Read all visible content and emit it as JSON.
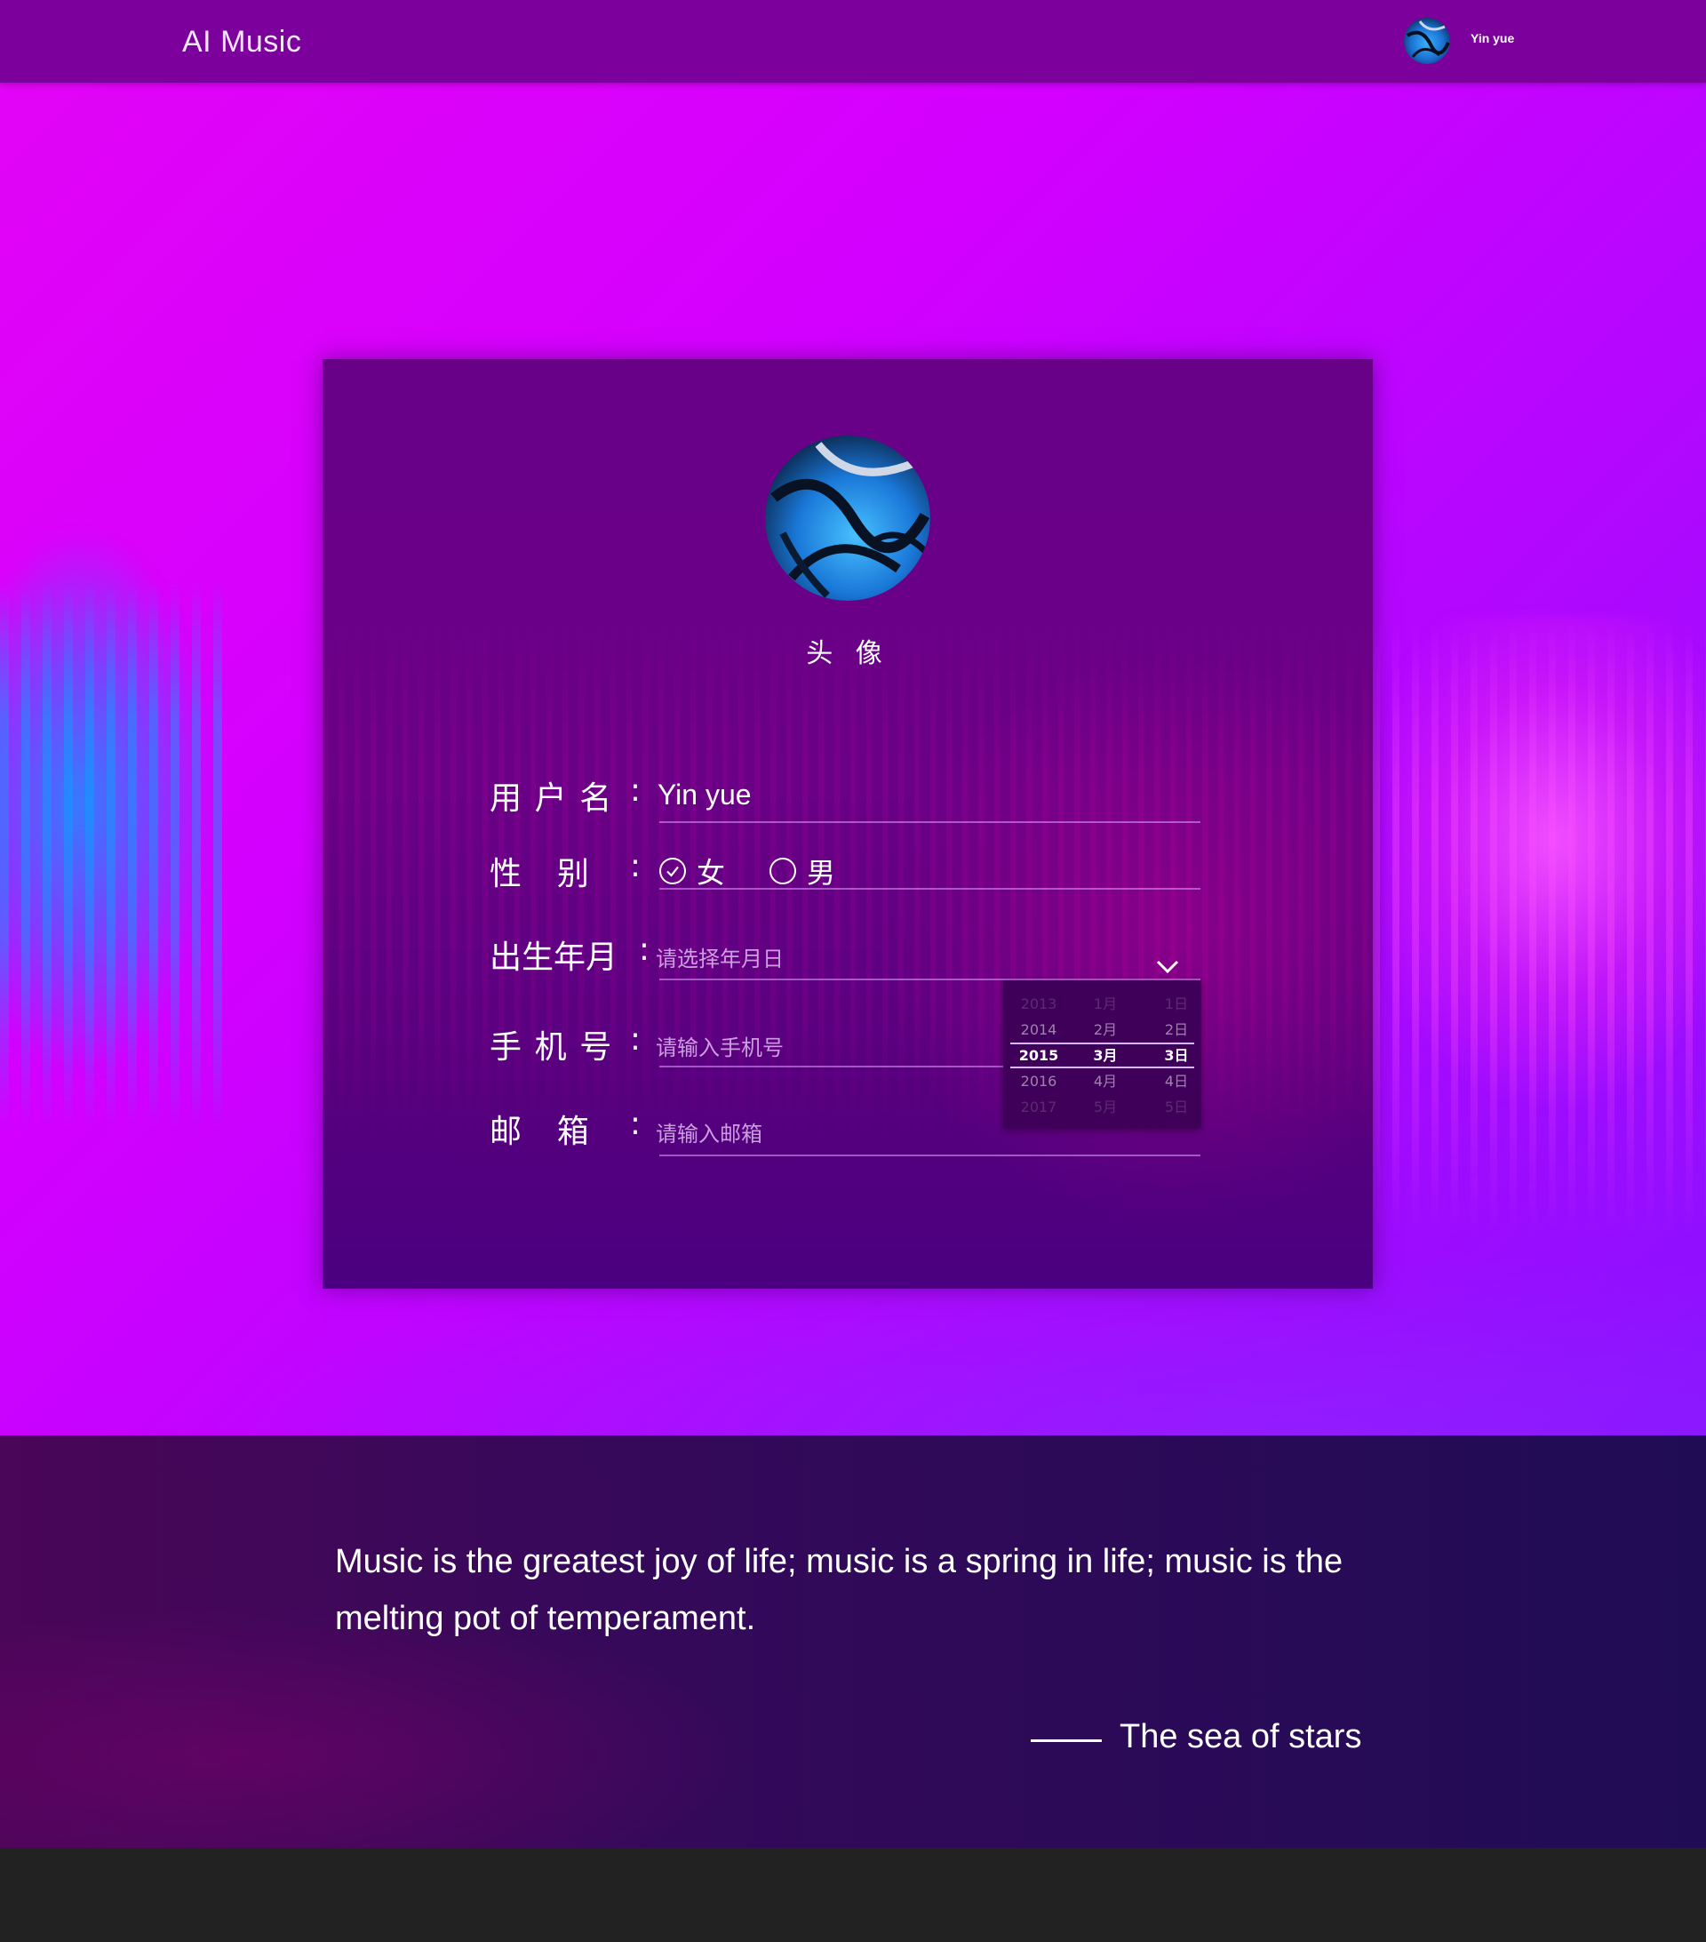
{
  "header": {
    "brand": "AI Music",
    "user_name": "Yin yue",
    "avatar_icon": "user-avatar-photo"
  },
  "profile": {
    "avatar_label": "头 像",
    "fields": {
      "username": {
        "label_chars": [
          "用",
          "户",
          "名"
        ],
        "value": "Yin yue"
      },
      "gender": {
        "label_chars": [
          "性",
          "别"
        ],
        "options": [
          {
            "label": "女",
            "checked": true,
            "icon": "check-circle-icon"
          },
          {
            "label": "男",
            "checked": false,
            "icon": "empty-circle-icon"
          }
        ]
      },
      "birthdate": {
        "label": "出生年月",
        "placeholder": "请选择年月日",
        "icon": "chevron-down-icon"
      },
      "phone": {
        "label_chars": [
          "手",
          "机",
          "号"
        ],
        "placeholder": "请输入手机号"
      },
      "email": {
        "label_chars": [
          "邮",
          "箱"
        ],
        "placeholder": "请输入邮箱"
      }
    },
    "colon": ":",
    "date_picker": {
      "years": [
        "2013",
        "2014",
        "2015",
        "2016",
        "2017"
      ],
      "months": [
        "1月",
        "2月",
        "3月",
        "4月",
        "5月"
      ],
      "days": [
        "1日",
        "2日",
        "3日",
        "4日",
        "5日"
      ],
      "selected": {
        "year": "2015",
        "month": "3月",
        "day": "3日"
      }
    }
  },
  "quote": {
    "text": "Music is the greatest joy of life; music is a spring in life; music is the melting pot of temperament.",
    "author": "The sea of stars"
  },
  "colors": {
    "header_bg": "#7c009c",
    "hero_bg": "#d300ff",
    "card_bg": "#680088",
    "quote_bg": "#2a0a58",
    "footer_bg": "#222222"
  }
}
